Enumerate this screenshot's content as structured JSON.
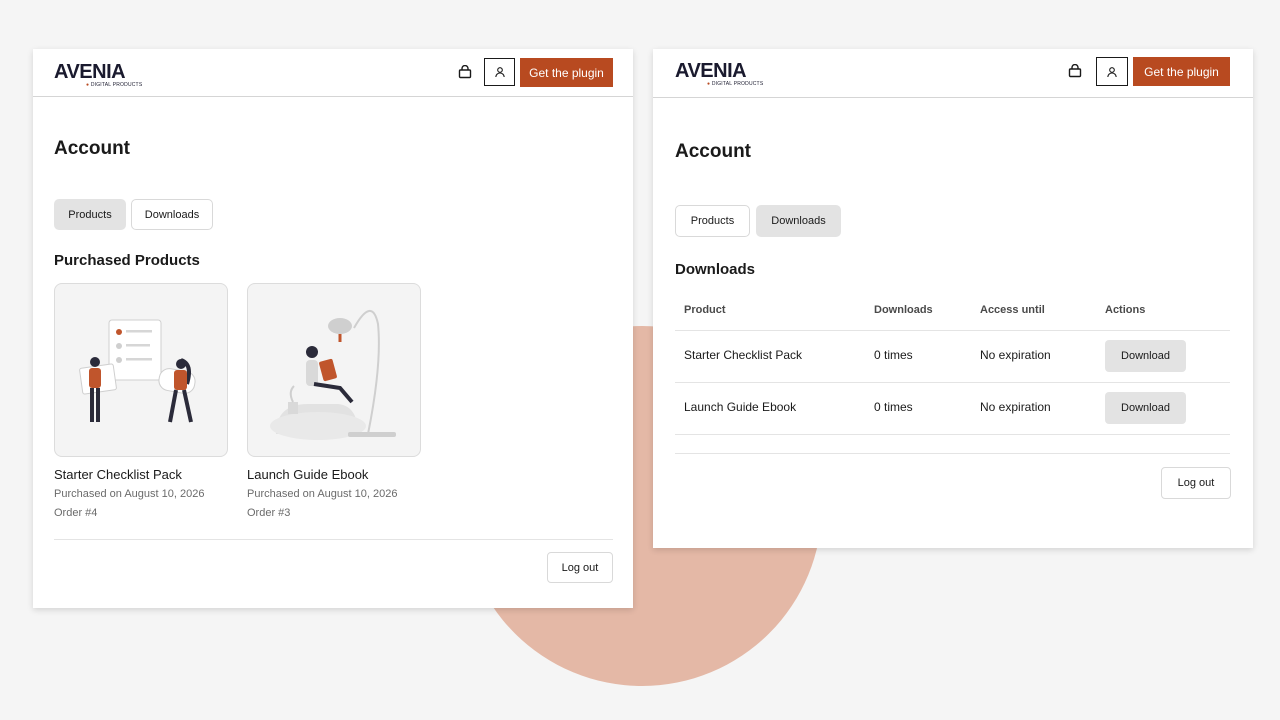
{
  "brand": {
    "name": "AVENIA",
    "tagline": "DIGITAL PRODUCTS",
    "accent": "#b84a20",
    "background_circle": "#e4b8a6"
  },
  "header": {
    "cta_label": "Get the plugin",
    "icons": [
      "shopping-bag-icon",
      "user-icon"
    ]
  },
  "products_page": {
    "title": "Account",
    "tabs": [
      {
        "label": "Products",
        "active": true
      },
      {
        "label": "Downloads",
        "active": false
      }
    ],
    "section_title": "Purchased Products",
    "products": [
      {
        "name": "Starter Checklist Pack",
        "purchased": "Purchased on August 10, 2026",
        "order": "Order #4"
      },
      {
        "name": "Launch Guide Ebook",
        "purchased": "Purchased on August 10, 2026",
        "order": "Order #3"
      }
    ],
    "logout_label": "Log out"
  },
  "downloads_page": {
    "title": "Account",
    "tabs": [
      {
        "label": "Products",
        "active": false
      },
      {
        "label": "Downloads",
        "active": true
      }
    ],
    "section_title": "Downloads",
    "columns": [
      "Product",
      "Downloads",
      "Access until",
      "Actions"
    ],
    "rows": [
      {
        "product": "Starter Checklist Pack",
        "downloads": "0 times",
        "access": "No expiration",
        "action": "Download"
      },
      {
        "product": "Launch Guide Ebook",
        "downloads": "0 times",
        "access": "No expiration",
        "action": "Download"
      }
    ],
    "logout_label": "Log out"
  }
}
